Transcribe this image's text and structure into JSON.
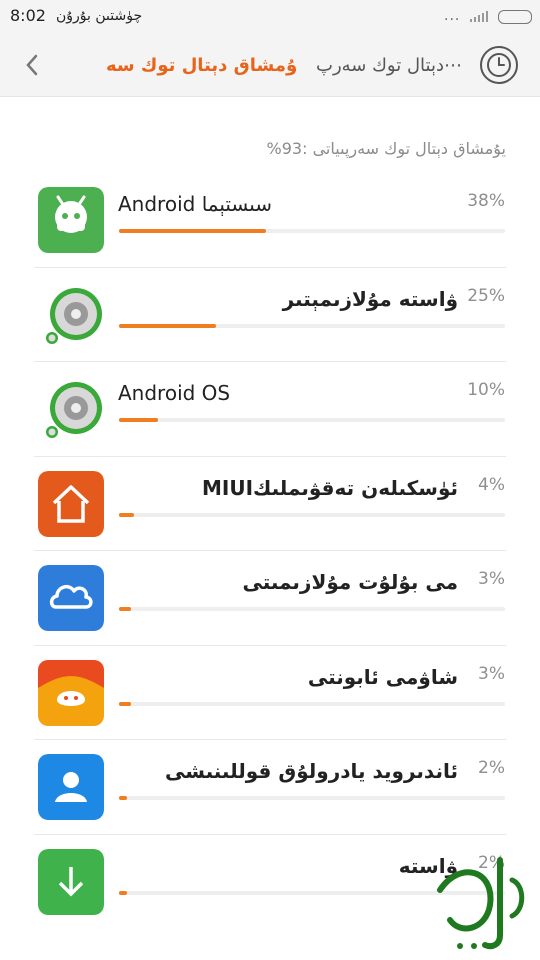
{
  "status": {
    "time": "8:02",
    "carrier": "چۈشتىن بۇرۇن",
    "dots": "...",
    "signal": "signal-icon",
    "battery": "battery-icon"
  },
  "header": {
    "back": "back-arrow-icon",
    "title_active": "يۇمشاق دېتال توك سە⋯",
    "title_other": "دېتال توك سەرپ⋯",
    "clock": "clock-icon"
  },
  "summary": "يۇمشاق دېتال توك سەرپىياتى :93%",
  "apps": [
    {
      "name": "Android سىستېما",
      "percent": "38%",
      "value": 38,
      "icon": "android-icon",
      "rtl": false
    },
    {
      "name": "ۋاستە مۇلازىمېتىر",
      "percent": "25%",
      "value": 25,
      "icon": "speaker-icon",
      "rtl": true
    },
    {
      "name": "Android OS",
      "percent": "10%",
      "value": 10,
      "icon": "speaker-icon",
      "rtl": false
    },
    {
      "name": "MIUIئۈسكىلەن تەقۋىملىك",
      "percent": "4%",
      "value": 4,
      "icon": "home-icon",
      "rtl": true
    },
    {
      "name": "مى بۇلۇت مۇلازىمىتى",
      "percent": "3%",
      "value": 3,
      "icon": "cloud-icon",
      "rtl": true
    },
    {
      "name": "شاۋمى ئابونتى",
      "percent": "3%",
      "value": 3,
      "icon": "mi-icon",
      "rtl": true
    },
    {
      "name": "ئاندىرويد يادرولۇق قوللىنىشى",
      "percent": "2%",
      "value": 2,
      "icon": "contact-icon",
      "rtl": true
    },
    {
      "name": "ۋاستە",
      "percent": "2%",
      "value": 2,
      "icon": "download-icon",
      "rtl": true
    }
  ],
  "watermark_text": "ئالقۇرى"
}
